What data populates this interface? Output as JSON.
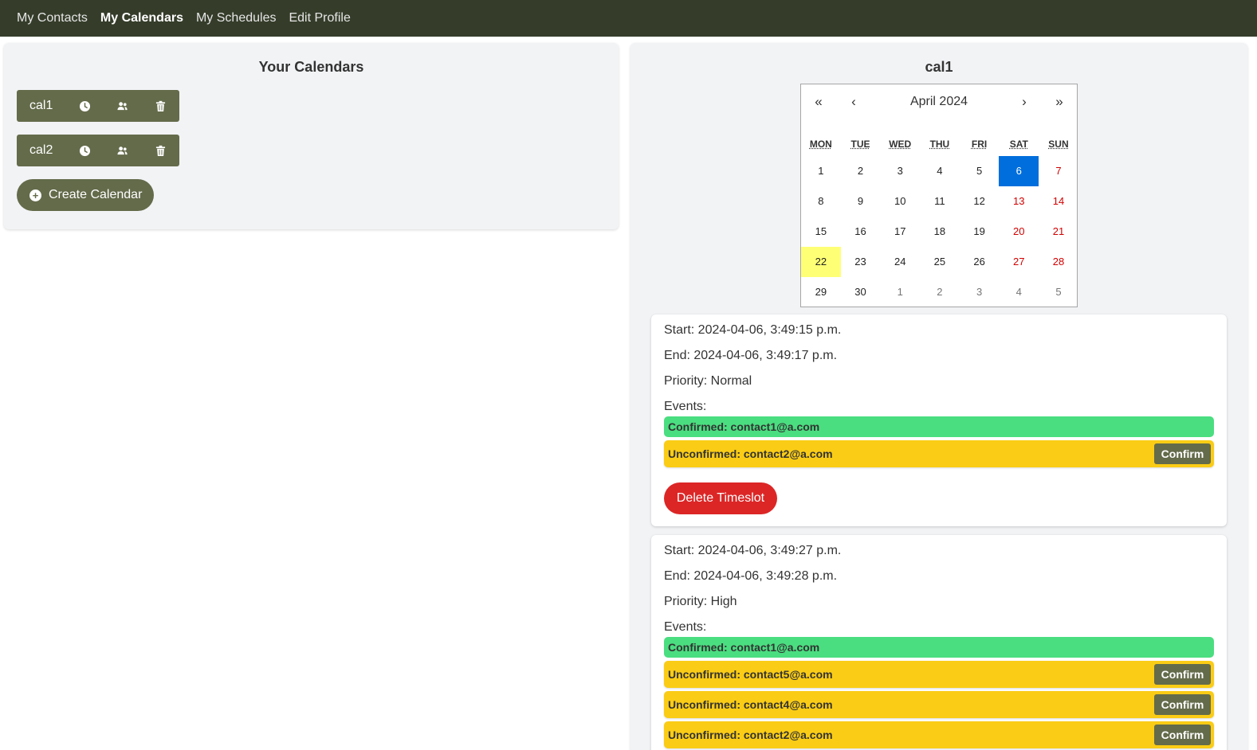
{
  "nav": {
    "items": [
      {
        "label": "My Contacts",
        "active": false
      },
      {
        "label": "My Calendars",
        "active": true
      },
      {
        "label": "My Schedules",
        "active": false
      },
      {
        "label": "Edit Profile",
        "active": false
      }
    ]
  },
  "left": {
    "title": "Your Calendars",
    "calendars": [
      {
        "name": "cal1",
        "icons": [
          "clock-icon",
          "users-icon",
          "trash-icon"
        ]
      },
      {
        "name": "cal2",
        "icons": [
          "clock-icon",
          "users-icon",
          "trash-icon"
        ]
      }
    ],
    "create_label": "Create Calendar",
    "create_icon": "plus-circle-icon"
  },
  "right": {
    "title": "cal1",
    "calendar": {
      "prev_year": "«",
      "prev_month": "‹",
      "month_label": "April 2024",
      "next_month": "›",
      "next_year": "»",
      "weekdays": [
        "MON",
        "TUE",
        "WED",
        "THU",
        "FRI",
        "SAT",
        "SUN"
      ],
      "weeks": [
        [
          "1",
          "2",
          "3",
          "4",
          "5",
          "6",
          "7"
        ],
        [
          "8",
          "9",
          "10",
          "11",
          "12",
          "13",
          "14"
        ],
        [
          "15",
          "16",
          "17",
          "18",
          "19",
          "20",
          "21"
        ],
        [
          "22",
          "23",
          "24",
          "25",
          "26",
          "27",
          "28"
        ],
        [
          "29",
          "30",
          "1",
          "2",
          "3",
          "4",
          "5"
        ]
      ],
      "selected_day": "6",
      "today_day": "22"
    },
    "timeslots": [
      {
        "start": "Start: 2024-04-06, 3:49:15 p.m.",
        "end": "End: 2024-04-06, 3:49:17 p.m.",
        "priority": "Priority: Normal",
        "events_label": "Events:",
        "events": [
          {
            "text": "Confirmed: contact1@a.com",
            "status": "confirmed"
          },
          {
            "text": "Unconfirmed: contact2@a.com",
            "status": "unconfirmed",
            "button": "Confirm"
          }
        ],
        "delete_label": "Delete Timeslot"
      },
      {
        "start": "Start: 2024-04-06, 3:49:27 p.m.",
        "end": "End: 2024-04-06, 3:49:28 p.m.",
        "priority": "Priority: High",
        "events_label": "Events:",
        "events": [
          {
            "text": "Confirmed: contact1@a.com",
            "status": "confirmed"
          },
          {
            "text": "Unconfirmed: contact5@a.com",
            "status": "unconfirmed",
            "button": "Confirm"
          },
          {
            "text": "Unconfirmed: contact4@a.com",
            "status": "unconfirmed",
            "button": "Confirm"
          },
          {
            "text": "Unconfirmed: contact2@a.com",
            "status": "unconfirmed",
            "button": "Confirm"
          }
        ]
      }
    ]
  },
  "colors": {
    "nav_bg": "#353d2a",
    "olive": "#636b4a",
    "confirmed": "#4ade80",
    "unconfirmed": "#facc15",
    "danger": "#dc2626",
    "selected_day": "#006edc",
    "today": "#ffff76"
  }
}
